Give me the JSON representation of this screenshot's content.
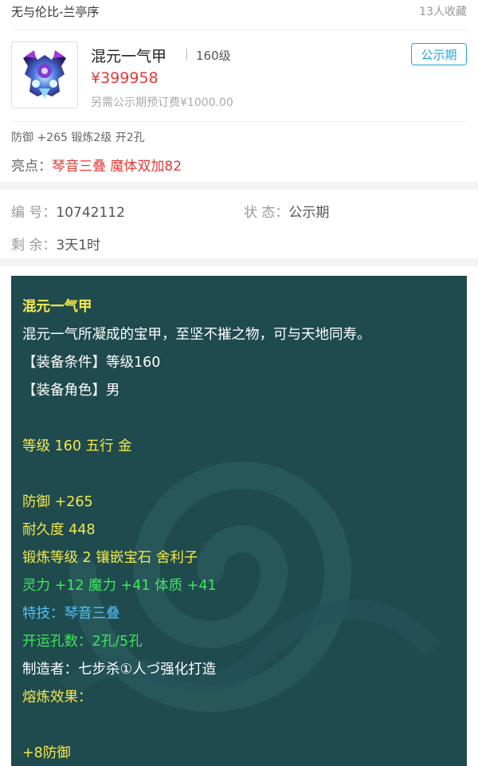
{
  "topbar": {
    "seller": "无与伦比-兰亭序",
    "favorites": "13人收藏"
  },
  "item": {
    "icon": "armor-item-icon",
    "name": "混元一气甲",
    "divider": "|",
    "level": "160级",
    "badge": "公示期",
    "price": "¥399958",
    "fee": "另需公示期预订费¥1000.00",
    "attributes": "防御 +265 锻炼2级 开2孔",
    "highlight_label": "亮点：",
    "highlight_value": "琴音三叠  魔体双加82"
  },
  "info": {
    "id_label": "编  号：",
    "id_value": "10742112",
    "status_label": "状  态：",
    "status_value": "公示期",
    "remain_label": "剩  余：",
    "remain_value": "3天1时"
  },
  "desc": {
    "lines": [
      {
        "text": "混元一气甲",
        "color": "#f4e94a"
      },
      {
        "text": "混元一气所凝成的宝甲，至坚不摧之物，可与天地同寿。",
        "color": "#ffffff"
      },
      {
        "text": "【装备条件】等级160",
        "color": "#ffffff"
      },
      {
        "text": "【装备角色】男",
        "color": "#ffffff"
      },
      {
        "text": "",
        "color": "#ffffff"
      },
      {
        "text": "等级 160 五行 金",
        "color": "#f4e94a"
      },
      {
        "text": "",
        "color": "#ffffff"
      },
      {
        "text": "防御 +265",
        "color": "#f4e94a"
      },
      {
        "text": "耐久度 448",
        "color": "#f4e94a"
      },
      {
        "text": "锻炼等级 2 镶嵌宝石 舍利子",
        "color": "#f4e94a"
      },
      {
        "text": "灵力 +12 魔力 +41 体质 +41",
        "color": "#3ee85a"
      },
      {
        "text": "特技：琴音三叠",
        "color": "#4fc3f7"
      },
      {
        "text": "开运孔数：2孔/5孔",
        "color": "#3ee85a"
      },
      {
        "text": "制造者：七步杀①人づ强化打造",
        "color": "#ffffff"
      },
      {
        "text": "熔炼效果：",
        "color": "#f4e94a"
      },
      {
        "text": "",
        "color": "#ffffff"
      },
      {
        "text": "+8防御",
        "color": "#f4e94a"
      }
    ]
  },
  "colors": {
    "price": "#e53935",
    "badge": "#29a3d8",
    "panel": "#1f4a4e"
  }
}
